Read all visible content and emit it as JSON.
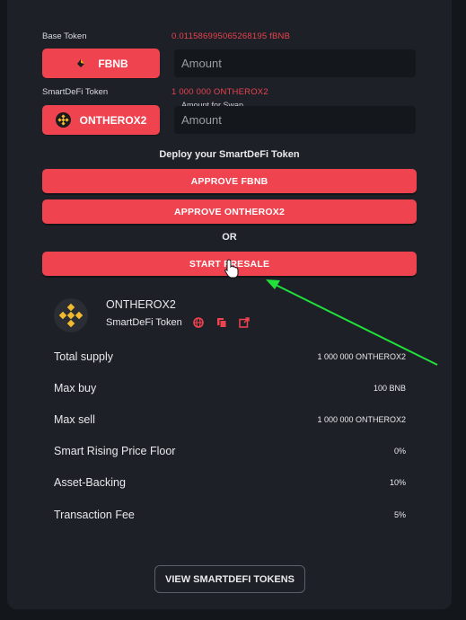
{
  "base": {
    "label": "Base Token",
    "balance": "0.011586995065268195 fBNB",
    "token": "FBNB",
    "icon": "fbnb-token-icon",
    "amount_placeholder": "Amount"
  },
  "smartdefi": {
    "label": "SmartDeFi Token",
    "balance": "1 000 000 ONTHEROX2",
    "token": "ONTHEROX2",
    "icon": "bnb-token-icon",
    "amount_label": "Amount for Swap",
    "amount_placeholder": "Amount"
  },
  "deploy": {
    "title": "Deploy your SmartDeFi Token",
    "approve_base": "APPROVE FBNB",
    "approve_token": "APPROVE ONTHEROX2",
    "or": "OR",
    "start_presale": "START PRESALE"
  },
  "token_info": {
    "name": "ONTHEROX2",
    "subtitle": "SmartDeFi Token",
    "icons": [
      "globe-icon",
      "copy-icon",
      "external-link-icon"
    ]
  },
  "stats": [
    {
      "key": "Total supply",
      "value": "1 000 000 ONTHEROX2"
    },
    {
      "key": "Max buy",
      "value": "100 BNB"
    },
    {
      "key": "Max sell",
      "value": "1 000 000 ONTHEROX2"
    },
    {
      "key": "Smart Rising Price Floor",
      "value": "0%"
    },
    {
      "key": "Asset-Backing",
      "value": "10%"
    },
    {
      "key": "Transaction Fee",
      "value": "5%"
    }
  ],
  "footer": {
    "view_tokens": "VIEW SMARTDEFI TOKENS"
  },
  "colors": {
    "accent": "#ef4350",
    "panel": "#1d2026",
    "background": "#13161b",
    "annotation_arrow": "#22e03a"
  }
}
